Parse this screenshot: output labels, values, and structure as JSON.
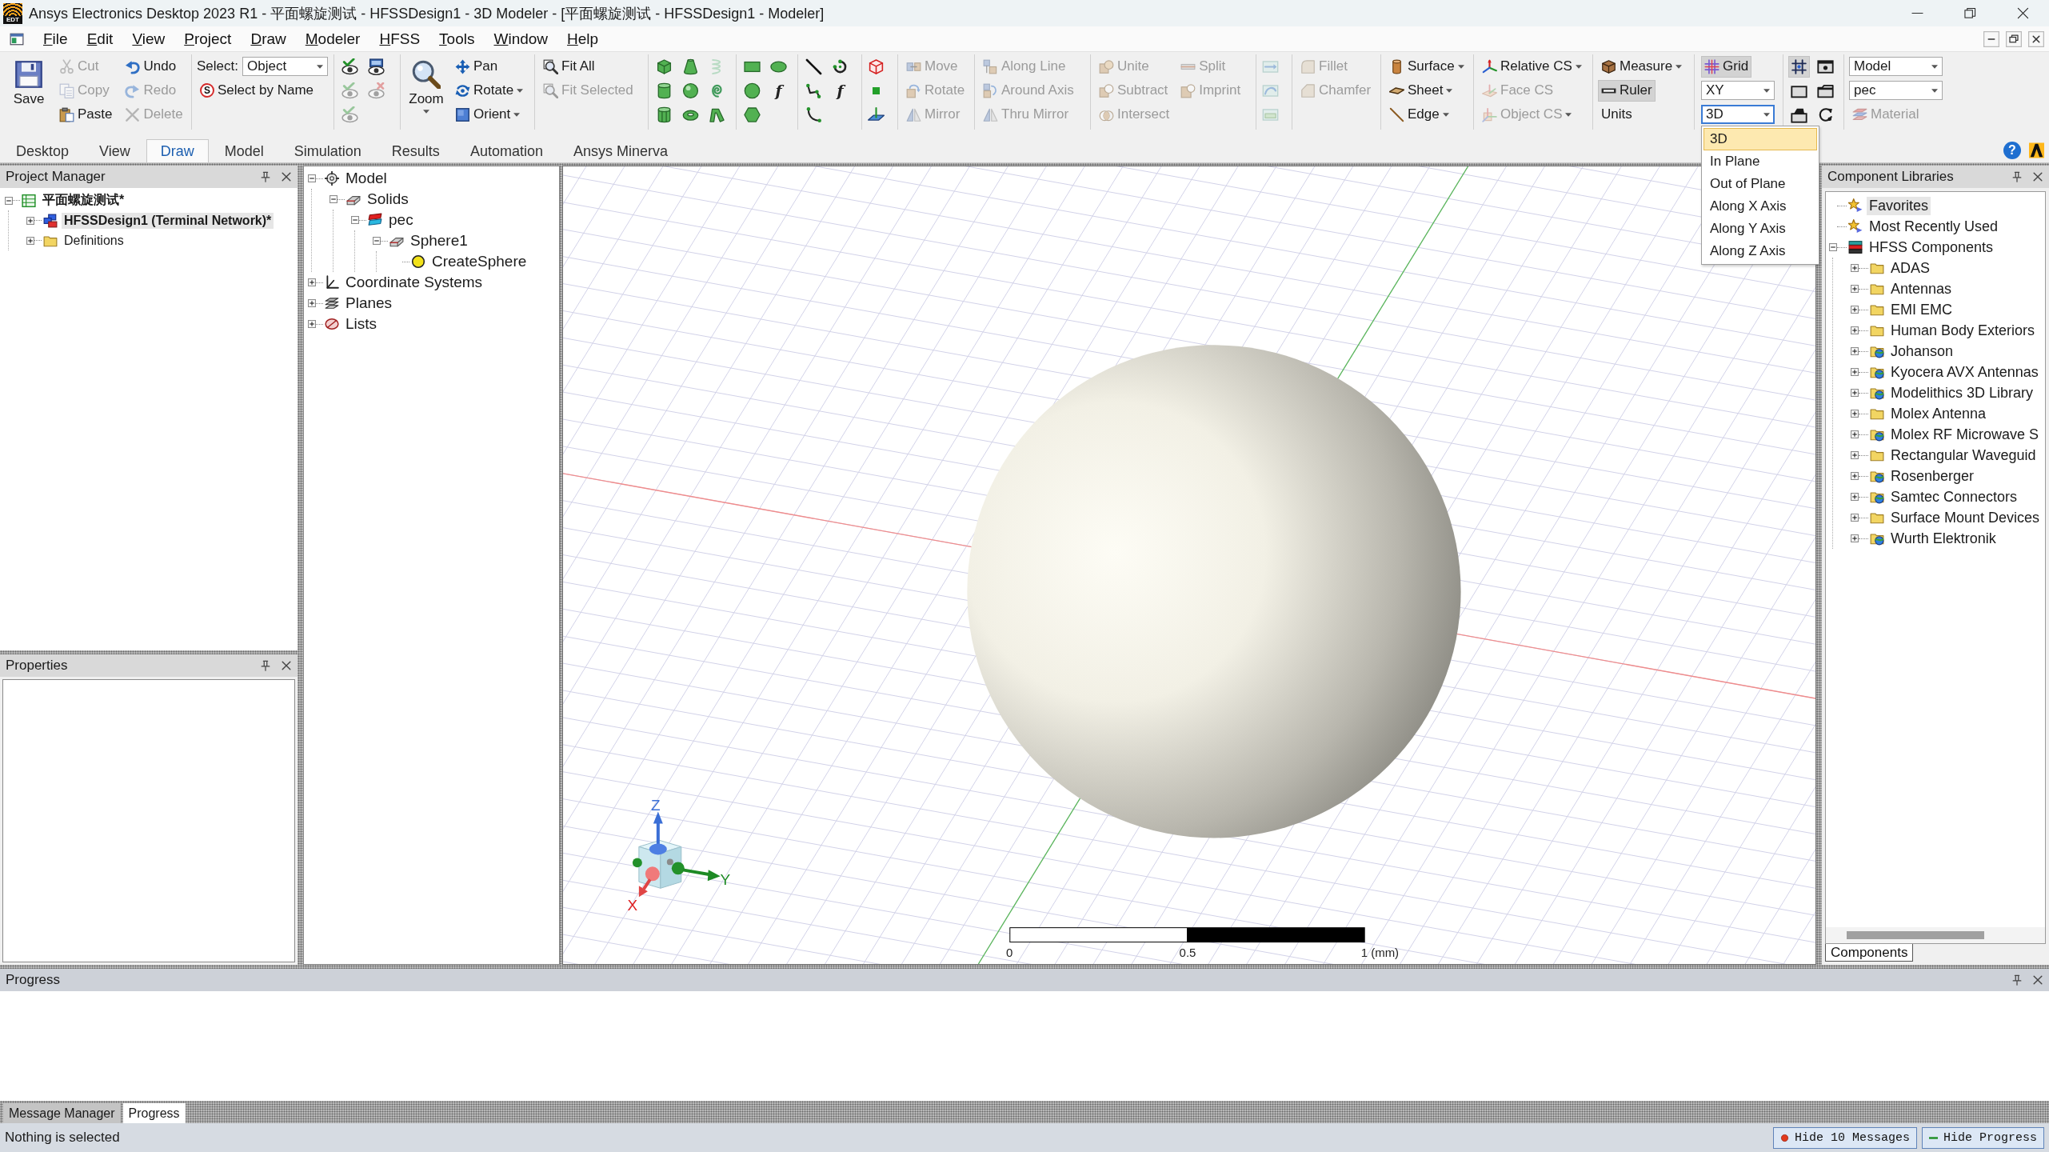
{
  "title_bar": {
    "app_icon_label": "EDT",
    "title": "Ansys Electronics Desktop 2023 R1 - 平面螺旋测试 - HFSSDesign1 - 3D Modeler - [平面螺旋测试 - HFSSDesign1 - Modeler]"
  },
  "menu_bar": {
    "items": [
      "File",
      "Edit",
      "View",
      "Project",
      "Draw",
      "Modeler",
      "HFSS",
      "Tools",
      "Window",
      "Help"
    ]
  },
  "ribbon": {
    "groups": [
      {
        "columns": [
          {
            "items": [
              {
                "kind": "large",
                "label": "Save",
                "menu": false,
                "disabled": false
              }
            ]
          },
          {
            "items": [
              {
                "kind": "button",
                "label": "Cut",
                "disabled": true
              },
              {
                "kind": "button",
                "label": "Copy",
                "disabled": true
              },
              {
                "kind": "button",
                "label": "Paste",
                "disabled": false
              }
            ]
          },
          {
            "items": [
              {
                "kind": "button",
                "label": "Undo",
                "disabled": false
              },
              {
                "kind": "button",
                "label": "Redo",
                "disabled": true
              },
              {
                "kind": "button",
                "label": "Delete",
                "disabled": true
              }
            ]
          }
        ]
      },
      {
        "columns": [
          {
            "items": [
              {
                "kind": "select",
                "label": "Select:",
                "value": "Object",
                "disabled": false
              },
              {
                "kind": "button",
                "label": "Select by Name",
                "glyph": "S",
                "disabled": false
              }
            ]
          }
        ]
      },
      {
        "columns": [
          {
            "items": [
              {
                "kind": "icon",
                "disabled": false
              },
              {
                "kind": "icon",
                "disabled": true
              },
              {
                "kind": "icon",
                "disabled": true
              }
            ]
          },
          {
            "items": [
              {
                "kind": "icon",
                "disabled": false
              },
              {
                "kind": "icon",
                "disabled": true
              }
            ]
          }
        ]
      },
      {
        "columns": [
          {
            "items": [
              {
                "kind": "large",
                "label": "Zoom",
                "menu": true,
                "disabled": false
              }
            ]
          },
          {
            "items": [
              {
                "kind": "button",
                "label": "Pan",
                "disabled": false
              },
              {
                "kind": "menu",
                "label": "Rotate",
                "disabled": false
              },
              {
                "kind": "menu",
                "label": "Orient",
                "disabled": false
              }
            ]
          }
        ]
      },
      {
        "columns": [
          {
            "items": [
              {
                "kind": "button",
                "label": "Fit All",
                "disabled": false
              },
              {
                "kind": "button",
                "label": "Fit Selected",
                "disabled": true
              }
            ]
          }
        ]
      },
      {
        "columns": [
          {
            "items": [
              {
                "kind": "icon",
                "disabled": false
              },
              {
                "kind": "icon",
                "disabled": false
              },
              {
                "kind": "icon",
                "disabled": false
              }
            ]
          },
          {
            "items": [
              {
                "kind": "icon",
                "disabled": false
              },
              {
                "kind": "icon",
                "disabled": false
              },
              {
                "kind": "icon",
                "disabled": false
              }
            ]
          },
          {
            "items": [
              {
                "kind": "icon",
                "disabled": true
              },
              {
                "kind": "icon",
                "disabled": false
              },
              {
                "kind": "icon",
                "disabled": false
              }
            ]
          }
        ]
      },
      {
        "columns": [
          {
            "items": [
              {
                "kind": "icon",
                "disabled": false
              },
              {
                "kind": "icon",
                "disabled": false
              },
              {
                "kind": "icon",
                "disabled": false
              }
            ]
          },
          {
            "items": [
              {
                "kind": "icon",
                "disabled": false
              },
              {
                "kind": "icon",
                "glyph": "f",
                "disabled": false
              }
            ]
          }
        ]
      },
      {
        "columns": [
          {
            "items": [
              {
                "kind": "icon",
                "disabled": false
              },
              {
                "kind": "icon",
                "disabled": false
              },
              {
                "kind": "icon",
                "disabled": false
              }
            ]
          },
          {
            "items": [
              {
                "kind": "icon",
                "disabled": false
              },
              {
                "kind": "icon",
                "glyph": "f",
                "disabled": false
              }
            ]
          }
        ]
      },
      {
        "columns": [
          {
            "items": [
              {
                "kind": "icon",
                "disabled": false
              },
              {
                "kind": "icon",
                "disabled": false
              },
              {
                "kind": "icon",
                "disabled": false
              }
            ]
          }
        ]
      },
      {
        "columns": [
          {
            "items": [
              {
                "kind": "button",
                "label": "Move",
                "disabled": true
              },
              {
                "kind": "button",
                "label": "Rotate",
                "disabled": true
              },
              {
                "kind": "button",
                "label": "Mirror",
                "disabled": true
              }
            ]
          }
        ]
      },
      {
        "columns": [
          {
            "items": [
              {
                "kind": "button",
                "label": "Along Line",
                "disabled": true
              },
              {
                "kind": "button",
                "label": "Around Axis",
                "disabled": true
              },
              {
                "kind": "button",
                "label": "Thru Mirror",
                "disabled": true
              }
            ]
          }
        ]
      },
      {
        "columns": [
          {
            "items": [
              {
                "kind": "button",
                "label": "Unite",
                "disabled": true
              },
              {
                "kind": "button",
                "label": "Subtract",
                "disabled": true
              },
              {
                "kind": "button",
                "label": "Intersect",
                "disabled": true
              }
            ]
          },
          {
            "items": [
              {
                "kind": "button",
                "label": "Split",
                "disabled": true
              },
              {
                "kind": "button",
                "label": "Imprint",
                "disabled": true
              }
            ]
          }
        ]
      },
      {
        "columns": [
          {
            "items": [
              {
                "kind": "icon",
                "disabled": true
              },
              {
                "kind": "icon",
                "disabled": true
              },
              {
                "kind": "icon",
                "disabled": true
              }
            ]
          }
        ]
      },
      {
        "columns": [
          {
            "items": [
              {
                "kind": "button",
                "label": "Fillet",
                "disabled": true
              },
              {
                "kind": "button",
                "label": "Chamfer",
                "disabled": true
              }
            ]
          }
        ]
      },
      {
        "columns": [
          {
            "items": [
              {
                "kind": "menu",
                "label": "Surface",
                "disabled": false
              },
              {
                "kind": "menu",
                "label": "Sheet",
                "disabled": false
              },
              {
                "kind": "menu",
                "label": "Edge",
                "disabled": false
              }
            ]
          }
        ]
      },
      {
        "columns": [
          {
            "items": [
              {
                "kind": "menu",
                "label": "Relative CS",
                "disabled": false
              },
              {
                "kind": "button",
                "label": "Face CS",
                "disabled": true
              },
              {
                "kind": "menu",
                "label": "Object CS",
                "disabled": true
              }
            ]
          }
        ]
      },
      {
        "columns": [
          {
            "items": [
              {
                "kind": "menu",
                "label": "Measure",
                "disabled": false
              },
              {
                "kind": "toggle",
                "label": "Ruler",
                "on": true,
                "disabled": false
              },
              {
                "kind": "button",
                "label": "Units",
                "disabled": false
              }
            ]
          }
        ]
      },
      {
        "columns": [
          {
            "items": [
              {
                "kind": "toggle",
                "label": "Grid",
                "on": true,
                "disabled": false
              },
              {
                "kind": "combo",
                "value": "XY",
                "expanded": false,
                "disabled": false
              },
              {
                "kind": "combo",
                "value": "3D",
                "expanded": true,
                "disabled": false,
                "options": [
                  {
                    "label": "3D",
                    "selected": true
                  },
                  {
                    "label": "In Plane",
                    "selected": false
                  },
                  {
                    "label": "Out of Plane",
                    "selected": false
                  },
                  {
                    "label": "Along X Axis",
                    "selected": false
                  },
                  {
                    "label": "Along Y Axis",
                    "selected": false
                  },
                  {
                    "label": "Along Z Axis",
                    "selected": false
                  }
                ]
              }
            ]
          }
        ]
      },
      {
        "columns": [
          {
            "items": [
              {
                "kind": "toggle",
                "on": true,
                "disabled": false
              },
              {
                "kind": "icon",
                "disabled": false
              },
              {
                "kind": "icon",
                "disabled": false
              }
            ]
          },
          {
            "items": [
              {
                "kind": "icon",
                "disabled": false
              },
              {
                "kind": "icon",
                "disabled": false
              },
              {
                "kind": "icon",
                "disabled": false
              }
            ]
          }
        ]
      },
      {
        "columns": [
          {
            "items": [
              {
                "kind": "combo",
                "value": "Model",
                "expanded": false,
                "disabled": false
              },
              {
                "kind": "combo",
                "value": "pec",
                "expanded": false,
                "disabled": false
              },
              {
                "kind": "button",
                "label": "Material",
                "disabled": true
              }
            ]
          }
        ]
      }
    ]
  },
  "ribbon_tabs": {
    "items": [
      {
        "label": "Desktop",
        "selected": false
      },
      {
        "label": "View",
        "selected": false
      },
      {
        "label": "Draw",
        "selected": true
      },
      {
        "label": "Model",
        "selected": false
      },
      {
        "label": "Simulation",
        "selected": false
      },
      {
        "label": "Results",
        "selected": false
      },
      {
        "label": "Automation",
        "selected": false
      },
      {
        "label": "Ansys Minerva",
        "selected": false
      }
    ],
    "help_glyph": "?"
  },
  "project_manager": {
    "title": "Project Manager",
    "tree": [
      {
        "label": "平面螺旋测试*",
        "expanded": true,
        "active": true,
        "selected": false,
        "children": [
          {
            "label": "HFSSDesign1 (Terminal Network)*",
            "expanded": false,
            "active": true,
            "selected": true
          },
          {
            "label": "Definitions",
            "expanded": false,
            "active": false,
            "selected": false
          }
        ]
      }
    ]
  },
  "properties": {
    "title": "Properties"
  },
  "model_tree": {
    "items": [
      {
        "label": "Model",
        "expanded": true,
        "selected": false,
        "children": [
          {
            "label": "Solids",
            "expanded": true,
            "selected": false,
            "children": [
              {
                "label": "pec",
                "expanded": true,
                "selected": false,
                "children": [
                  {
                    "label": "Sphere1",
                    "expanded": true,
                    "selected": false,
                    "children": [
                      {
                        "label": "CreateSphere",
                        "selected": false
                      }
                    ]
                  }
                ]
              }
            ]
          }
        ]
      },
      {
        "label": "Coordinate Systems",
        "expanded": false,
        "selected": false
      },
      {
        "label": "Planes",
        "expanded": false,
        "selected": false
      },
      {
        "label": "Lists",
        "expanded": false,
        "selected": false
      }
    ]
  },
  "viewport": {
    "triad": {
      "x_label": "X",
      "y_label": "Y",
      "z_label": "Z"
    },
    "scale_labels": [
      "0",
      "0.5",
      "1 (mm)"
    ]
  },
  "component_libraries": {
    "title": "Component Libraries",
    "tree": [
      {
        "label": "Favorites",
        "selected": true
      },
      {
        "label": "Most Recently Used",
        "selected": false
      },
      {
        "label": "HFSS Components",
        "expanded": true,
        "selected": false,
        "children": [
          {
            "label": "ADAS",
            "kind": "folder",
            "expanded": false,
            "selected": false
          },
          {
            "label": "Antennas",
            "kind": "folder",
            "expanded": false,
            "selected": false
          },
          {
            "label": "EMI EMC",
            "kind": "folder",
            "expanded": false,
            "selected": false
          },
          {
            "label": "Human Body Exteriors",
            "kind": "folder",
            "expanded": false,
            "selected": false
          },
          {
            "label": "Johanson",
            "kind": "vendor",
            "expanded": false,
            "selected": false
          },
          {
            "label": "Kyocera AVX Antennas",
            "kind": "vendor",
            "expanded": false,
            "selected": false
          },
          {
            "label": "Modelithics 3D Library",
            "kind": "vendor",
            "expanded": false,
            "selected": false
          },
          {
            "label": "Molex Antenna",
            "kind": "folder",
            "expanded": false,
            "selected": false
          },
          {
            "label": "Molex RF Microwave S",
            "kind": "vendor",
            "expanded": false,
            "selected": false
          },
          {
            "label": "Rectangular Waveguid",
            "kind": "folder",
            "expanded": false,
            "selected": false
          },
          {
            "label": "Rosenberger",
            "kind": "vendor",
            "expanded": false,
            "selected": false
          },
          {
            "label": "Samtec Connectors",
            "kind": "vendor",
            "expanded": false,
            "selected": false
          },
          {
            "label": "Surface Mount Devices",
            "kind": "folder",
            "expanded": false,
            "selected": false
          },
          {
            "label": "Wurth Elektronik",
            "kind": "vendor",
            "expanded": false,
            "selected": false
          }
        ]
      }
    ],
    "tabs": [
      {
        "label": "Components",
        "selected": true
      }
    ]
  },
  "progress_panel": {
    "title": "Progress"
  },
  "output_tabs": [
    {
      "label": "Message Manager",
      "selected": false
    },
    {
      "label": "Progress",
      "selected": true
    }
  ],
  "status_bar": {
    "text": "Nothing is selected",
    "buttons": [
      "Hide 10 Messages",
      "Hide Progress"
    ]
  }
}
